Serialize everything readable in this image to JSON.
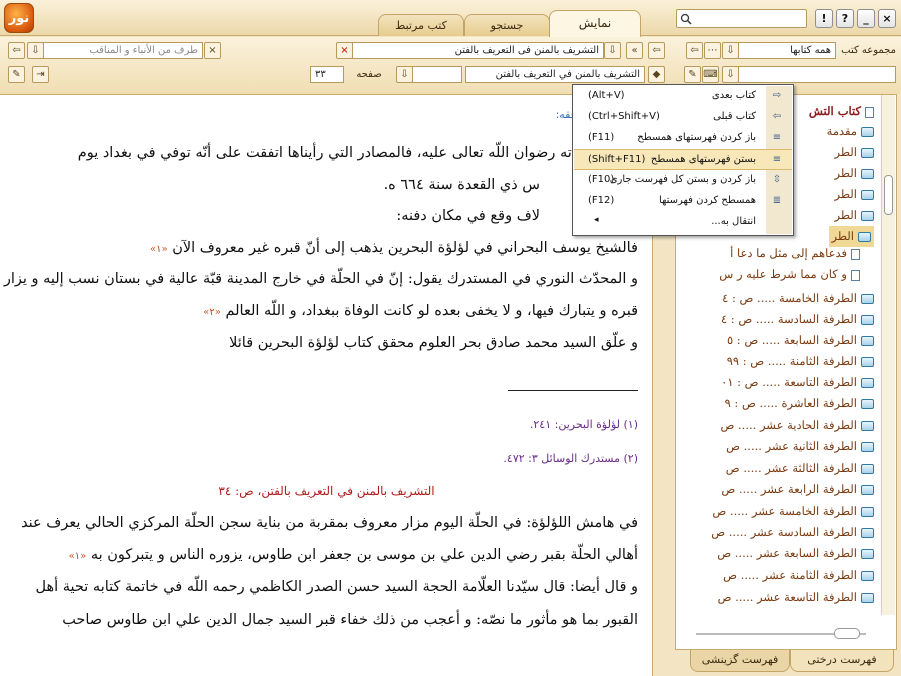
{
  "titlebar": {
    "logo_text": "نور",
    "tabs": [
      {
        "label": "نمایش",
        "active": true
      },
      {
        "label": "جستجو",
        "active": false
      },
      {
        "label": "کتب مرتبط",
        "active": false
      }
    ],
    "search_placeholder": "",
    "buttons": {
      "help": "?",
      "info": "!",
      "minimize": "_",
      "close": "×"
    }
  },
  "toolbar1": {
    "back": "⇦",
    "forward": "⇨",
    "title_field": "التشریف بالمنن فی التعریف بالفتن",
    "related_field": "طرف من الأنباء و المناقب",
    "collection_label": "مجموعه کتب",
    "collection_value": "همه کتابها"
  },
  "toolbar2": {
    "breadcrumb_field": "التشريف بالمنن في التعريف بالفتن",
    "page_label": "صفحه",
    "page_value": "۳۳"
  },
  "document": {
    "header_fragment": "فقه:",
    "lines": [
      "لافا في وفاته رضوان اللّه تعالى عليه، فالمصادر التي رأيناها اتفقت على أنّه توفي في بغداد يوم",
      "س ذي القعدة سنة ٦٦٤ ه.",
      "لاف وقع في مكان دفنه:",
      "فالشيخ يوسف البحراني في لؤلؤة البحرين يذهب إلى أنّ قبره غير معروف الآن",
      "و المحدّث النوري في المستدرك يقول: إنّ في الحلّة في خارج المدينة قبّة عالية في بستان نسب إليه و يزار",
      "قبره و يتبارك فيها، و لا يخفى بعده لو كانت الوفاة ببغداد، و اللّه العالم",
      "و علّق السيد محمد صادق بحر العلوم محقق كتاب لؤلؤة البحرين قائلا"
    ],
    "footnote_refs": [
      "«۱»",
      "«۲»",
      "«۱»"
    ],
    "footnotes": [
      "(۱) لؤلؤة البحرين: ۲٤١.",
      "(۲) مستدرك الوسائل ۳: ٤٧۲."
    ],
    "page_header": "التشريف بالمنن في التعريف بالفتن، ص: ٣٤",
    "lines2": [
      "في هامش اللؤلؤة: في الحلّة اليوم مزار معروف بمقربة من بناية سجن الحلّة المركزي الحالي يعرف عند",
      "أهالي الحلّة بقبر رضي الدين علي بن موسى بن جعفر ابن طاوس، يزوره الناس و يتبركون به",
      "و قال أيضا: قال سيّدنا العلّامة الحجة السيد حسن الصدر الكاظمي رحمه اللّه في خاتمة كتابه تحية أهل",
      "القبور بما هو مأثور ما نصّه: و أعجب من ذلك خفاء قبر السيد جمال الدين علي ابن طاوس صاحب"
    ]
  },
  "tree": {
    "root": "كتاب التش",
    "items": [
      {
        "label": "مقدمة",
        "type": "folder"
      },
      {
        "label": "الطر",
        "type": "folder"
      },
      {
        "label": "الطر",
        "type": "folder"
      },
      {
        "label": "الطر",
        "type": "folder"
      },
      {
        "label": "الطر",
        "type": "folder"
      },
      {
        "label": "الطر",
        "type": "selected"
      },
      {
        "label": "فدعاهم إلى مثل ما دعا أ",
        "type": "page"
      },
      {
        "label": "و كان مما شرط عليه ر س",
        "type": "page"
      },
      {
        "label": "الطرفة الخامسة ..... ص : ٤",
        "type": "folder"
      },
      {
        "label": "الطرفة السادسة ..... ص : ٤",
        "type": "folder"
      },
      {
        "label": "الطرفة السابعة ..... ص : ٥",
        "type": "folder"
      },
      {
        "label": "الطرفة الثامنة ..... ص : ٩٩",
        "type": "folder"
      },
      {
        "label": "الطرفة التاسعة ..... ص : ٠١",
        "type": "folder"
      },
      {
        "label": "الطرفة العاشرة ..... ص : ٩",
        "type": "folder"
      },
      {
        "label": "الطرفة الحادية عشر ..... ص",
        "type": "folder"
      },
      {
        "label": "الطرفة الثانية عشر ..... ص",
        "type": "folder"
      },
      {
        "label": "الطرفة الثالثة عشر ..... ص",
        "type": "folder"
      },
      {
        "label": "الطرفة الرابعة عشر ..... ص",
        "type": "folder"
      },
      {
        "label": "الطرفة الخامسة عشر ..... ص",
        "type": "folder"
      },
      {
        "label": "الطرفة السادسة عشر ..... ص",
        "type": "folder"
      },
      {
        "label": "الطرفة السابعة عشر ..... ص",
        "type": "folder"
      },
      {
        "label": "الطرفة الثامنة عشر ..... ص",
        "type": "folder"
      },
      {
        "label": "الطرفة التاسعة عشر ..... ص",
        "type": "folder"
      }
    ],
    "bottom_tabs": [
      "فهرست درختی",
      "فهرست گزینشی"
    ]
  },
  "context_menu": {
    "items": [
      {
        "label": "کتاب بعدی",
        "shortcut": "(Alt+V)",
        "icon": "next-book-icon"
      },
      {
        "label": "کتاب قبلی",
        "shortcut": "(Ctrl+Shift+V)",
        "icon": "previous-book-icon"
      },
      {
        "label": "باز کردن فهرستهای همسطح",
        "shortcut": "(F11)",
        "icon": "expand-level-icon"
      },
      {
        "label": "بستن فهرستهای همسطح",
        "shortcut": "(Shift+F11)",
        "icon": "collapse-level-icon",
        "highlighted": true
      },
      {
        "label": "باز کردن و بستن کل فهرست جاری",
        "shortcut": "(F10)",
        "icon": "toggle-all-icon"
      },
      {
        "label": "همسطح کردن فهرستها",
        "shortcut": "(F12)",
        "icon": "flatten-icon"
      },
      {
        "label": "انتقال به...",
        "shortcut": "",
        "icon": "",
        "submenu": true
      }
    ]
  }
}
